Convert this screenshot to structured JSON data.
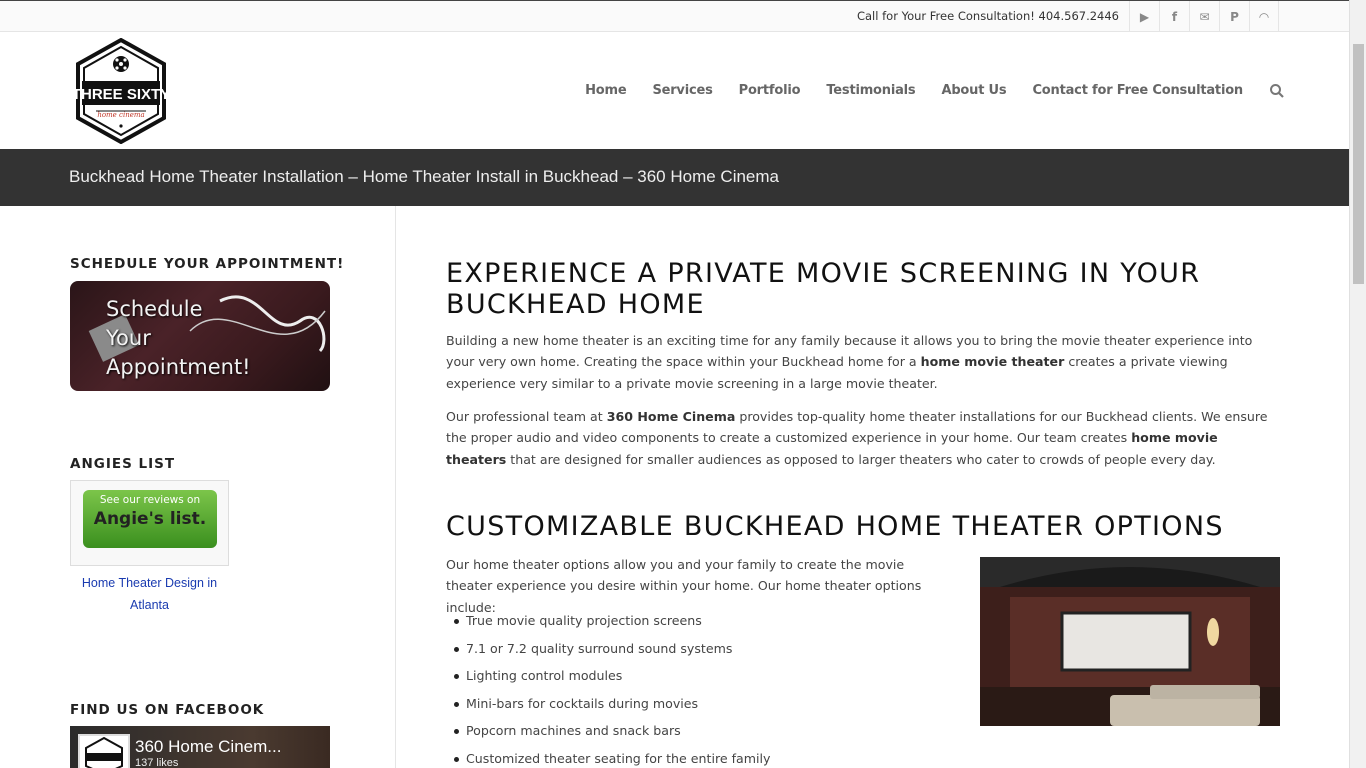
{
  "topbar": {
    "phone": "Call for Your Free Consultation! 404.567.2446",
    "social": [
      {
        "name": "youtube-icon",
        "glyph": "▶"
      },
      {
        "name": "facebook-icon",
        "glyph": "f"
      },
      {
        "name": "mail-icon",
        "glyph": "✉"
      },
      {
        "name": "pinterest-icon",
        "glyph": "P"
      },
      {
        "name": "rss-icon",
        "glyph": "◠"
      }
    ]
  },
  "logo": {
    "line1": "THREE SIXTY",
    "line2": "home cinema"
  },
  "nav": {
    "items": [
      "Home",
      "Services",
      "Portfolio",
      "Testimonials",
      "About Us",
      "Contact for Free Consultation"
    ]
  },
  "title": "Buckhead Home Theater Installation – Home Theater Install in Buckhead – 360 Home Cinema",
  "sidebar": {
    "schedule_title": "SCHEDULE YOUR APPOINTMENT!",
    "schedule_img_text": [
      "Schedule",
      "Your",
      "Appointment!"
    ],
    "angies_title": "ANGIES LIST",
    "angies_badge_line1": "See our reviews on",
    "angies_badge_line2": "Angie's list.",
    "angies_link": "Home Theater Design in Atlanta",
    "facebook_title": "FIND US ON FACEBOOK",
    "facebook_page": "360 Home Cinem...",
    "facebook_likes": "137 likes"
  },
  "main": {
    "heading1": "EXPERIENCE A PRIVATE MOVIE SCREENING IN YOUR BUCKHEAD HOME",
    "p1_a": "Building a new home theater is an exciting time for any family because it allows you to bring the movie theater experience into your very own home. Creating the space within your Buckhead home for a ",
    "p1_b": "home movie theater",
    "p1_c": " creates a private viewing experience very similar to a private movie screening in a large movie theater.",
    "p2_a": "Our professional team at ",
    "p2_b": "360 Home Cinema",
    "p2_c": " provides top-quality home theater installations for our Buckhead clients. We ensure the proper audio and video components to create a customized experience in your home. Our team creates ",
    "p2_d": "home movie theaters",
    "p2_e": " that are designed for smaller audiences as opposed to larger theaters who cater to crowds of people every day.",
    "heading2": "CUSTOMIZABLE BUCKHEAD HOME THEATER OPTIONS",
    "p3": "Our home theater options allow you and your family to create the movie theater experience you desire within your home. Our home theater options include:",
    "options": [
      "True movie quality projection screens",
      "7.1 or 7.2 quality surround sound systems",
      "Lighting control modules",
      "Mini-bars for cocktails during movies",
      "Popcorn machines and snack bars",
      "Customized theater seating for the entire family"
    ]
  },
  "colors": {
    "titlebar_bg": "#333333",
    "link": "#1a3bb0",
    "angies_green": "#5aa832"
  }
}
